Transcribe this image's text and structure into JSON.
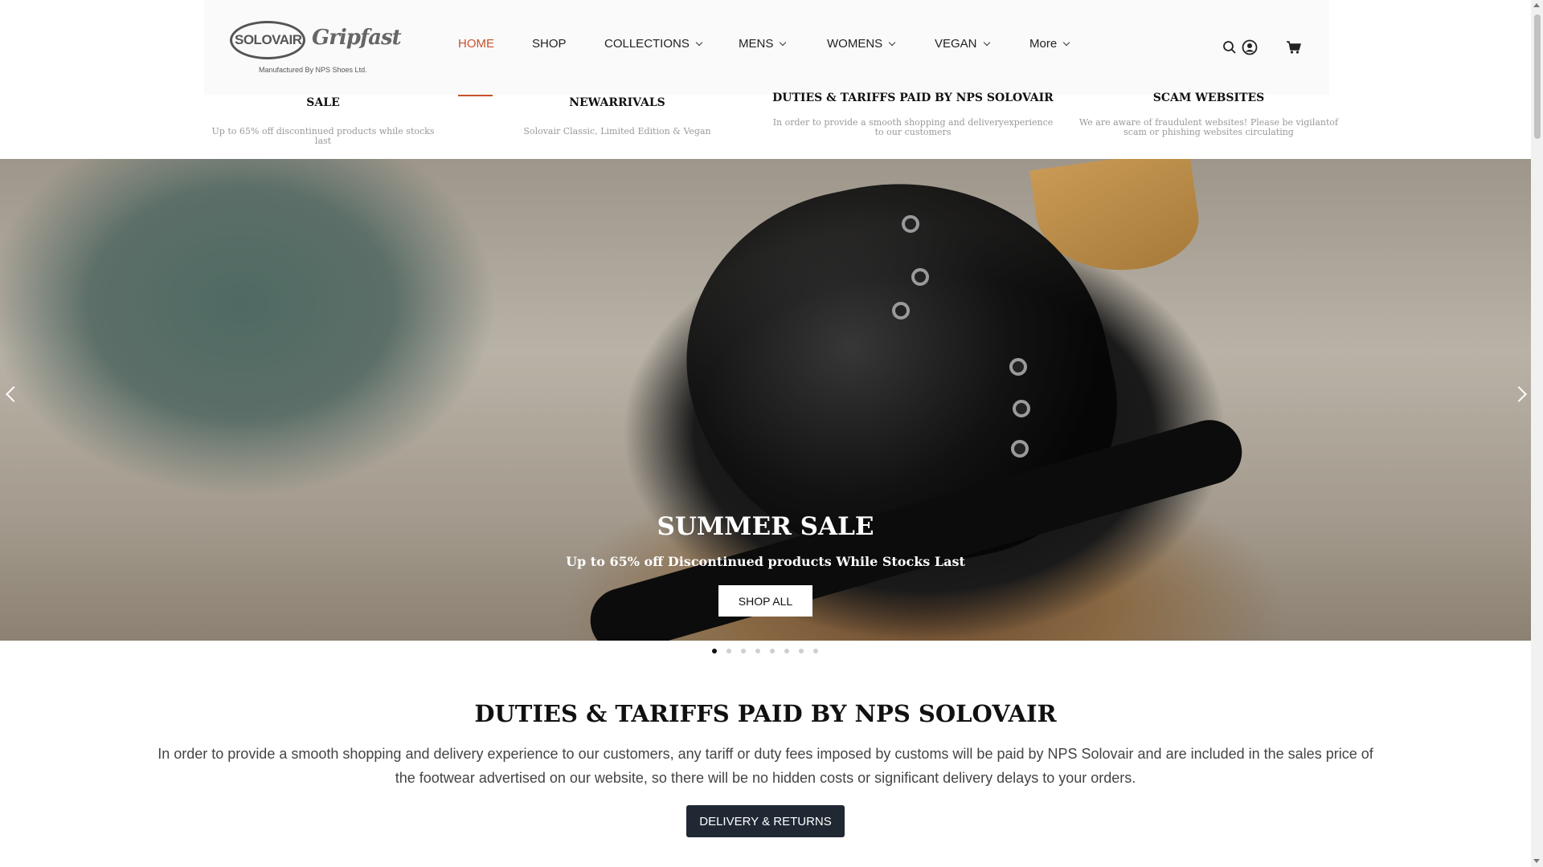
{
  "logo": {
    "brand1": "SOLOVAIR",
    "brand2": "Gripfast",
    "tagline": "Manufactured By NPS Shoes Ltd."
  },
  "nav": {
    "items": [
      {
        "label": "HOME",
        "active": true
      },
      {
        "label": "SHOP",
        "dropdown": false
      },
      {
        "label": "COLLECTIONS",
        "dropdown": true
      },
      {
        "label": "MENS",
        "dropdown": true
      },
      {
        "label": "WOMENS",
        "dropdown": true
      },
      {
        "label": "VEGAN",
        "dropdown": true
      },
      {
        "label": "More",
        "dropdown": true
      }
    ],
    "accent_color": "#c8512c"
  },
  "header_icons": [
    "search-icon",
    "account-icon",
    "cart-icon"
  ],
  "promos": [
    {
      "title": "SALE",
      "subtitle": "Up to 65% off discontinued products while stocks last"
    },
    {
      "title": "NEWARRIVALS",
      "subtitle": "Solovair Classic, Limited Edition & Vegan"
    },
    {
      "title": "DUTIES & TARIFFS PAID BY NPS SOLOVAIR",
      "subtitle": "In order to provide a smooth shopping and deliveryexperience to our customers"
    },
    {
      "title": "SCAM WEBSITES",
      "subtitle": "We are aware of fraudulent websites! Please be vigilantof scam or phishing websites circulating"
    }
  ],
  "hero": {
    "title": "SUMMER SALE",
    "subtitle": "Up to 65% off Discontinued products While Stocks Last",
    "button": "SHOP ALL",
    "slide_count": 8,
    "active_slide": 1
  },
  "info": {
    "title": "DUTIES & TARIFFS PAID BY NPS SOLOVAIR",
    "text": "In order to provide a smooth shopping and delivery experience to our customers, any tariff or duty fees imposed by customs will be paid by NPS Solovair and are included in the sales price of the footwear advertised on our website, so there will be no hidden costs or significant delivery delays to your orders.",
    "button": "DELIVERY & RETURNS",
    "button_color": "#1f2833"
  }
}
